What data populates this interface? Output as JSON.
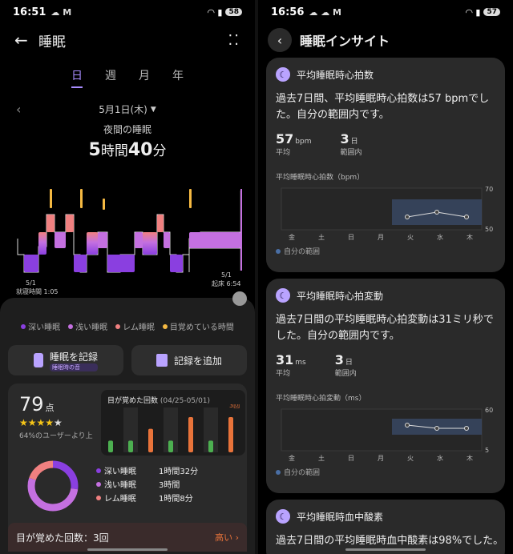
{
  "left": {
    "status": {
      "time": "16:51",
      "icons": "☁ M",
      "battery": "58"
    },
    "title": "睡眠",
    "tabs": [
      "日",
      "週",
      "月",
      "年"
    ],
    "date": "5月1日(木)",
    "night_label": "夜間の睡眠",
    "duration": {
      "h": "5",
      "h_unit": "時間",
      "m": "40",
      "m_unit": "分"
    },
    "chart": {
      "start_date": "5/1",
      "start_label": "就寝時間 1:05",
      "end_date": "5/1",
      "end_label": "起床 6:54"
    },
    "legend": [
      {
        "label": "深い睡眠",
        "color": "#8a3fe0"
      },
      {
        "label": "浅い睡眠",
        "color": "#c470e0"
      },
      {
        "label": "レム睡眠",
        "color": "#f08080"
      },
      {
        "label": "目覚めている時間",
        "color": "#f5b942"
      }
    ],
    "actions": {
      "record": "睡眠を記録",
      "record_sub": "睡眠時の音",
      "add": "記録を追加"
    },
    "score": {
      "value": "79",
      "unit": "点",
      "stars": 4,
      "percentile": "64%のユーザーより上"
    },
    "wake": {
      "title": "目が覚めた回数",
      "range": "(04/25-05/01)",
      "highlight": "3回",
      "values": [
        1,
        1,
        2,
        1,
        3,
        1,
        3
      ]
    },
    "stages": [
      {
        "name": "深い睡眠",
        "time": "1時間32分",
        "color": "#8a3fe0"
      },
      {
        "name": "浅い睡眠",
        "time": "3時間",
        "color": "#c470e0"
      },
      {
        "name": "レム睡眠",
        "time": "1時間8分",
        "color": "#f08080"
      }
    ],
    "wake_row": {
      "label": "目が覚めた回数：3回",
      "level": "高い ›"
    }
  },
  "right": {
    "status": {
      "time": "16:56",
      "icons": "☁ ☁ M",
      "battery": "57"
    },
    "title": "睡眠インサイト",
    "days": [
      "金",
      "土",
      "日",
      "月",
      "火",
      "水",
      "木"
    ],
    "cards": [
      {
        "name": "平均睡眠時心拍数",
        "desc": "過去7日間、平均睡眠時心拍数は57 bpmでした。自分の範囲内です。",
        "stat1": {
          "value": "57",
          "unit": "bpm",
          "label": "平均"
        },
        "stat2": {
          "value": "3",
          "unit": "日",
          "label": "範囲内"
        },
        "chart_label": "平均睡眠時心拍数（bpm）",
        "ymax": "70",
        "ymin": "50",
        "range_label": "自分の範囲"
      },
      {
        "name": "平均睡眠時心拍変動",
        "desc": "過去7日間の平均睡眠時心拍変動は31ミリ秒でした。自分の範囲内です。",
        "stat1": {
          "value": "31",
          "unit": "ms",
          "label": "平均"
        },
        "stat2": {
          "value": "3",
          "unit": "日",
          "label": "範囲内"
        },
        "chart_label": "平均睡眠時心拍変動（ms）",
        "ymax": "60",
        "ymin": "5",
        "range_label": "自分の範囲"
      },
      {
        "name": "平均睡眠時血中酸素",
        "desc": "過去7日間の平均睡眠時血中酸素は98%でした。"
      }
    ]
  }
}
